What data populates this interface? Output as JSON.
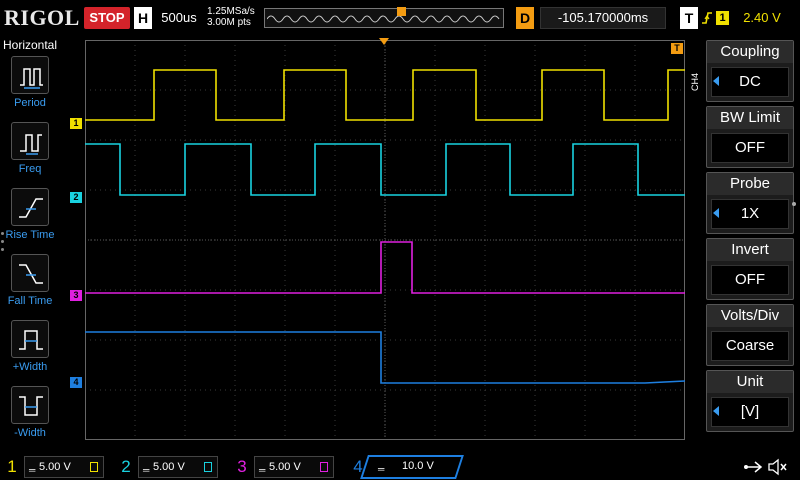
{
  "topbar": {
    "brand": "RIGOL",
    "run_status": "STOP",
    "horizontal_badge": "H",
    "timebase": "500us",
    "sample_rate": "1.25MSa/s",
    "memory_depth": "3.00M pts",
    "delay_badge": "D",
    "delay_value": "-105.170000ms",
    "trigger_badge": "T",
    "trigger_edge_icon": "rising-edge-icon",
    "trigger_source": "1",
    "trigger_level": "2.40 V"
  },
  "left_panel": {
    "title": "Horizontal",
    "items": [
      {
        "label": "Period",
        "icon": "period-icon"
      },
      {
        "label": "Freq",
        "icon": "freq-icon"
      },
      {
        "label": "Rise Time",
        "icon": "rise-time-icon"
      },
      {
        "label": "Fall Time",
        "icon": "fall-time-icon"
      },
      {
        "label": "+Width",
        "icon": "positive-width-icon"
      },
      {
        "label": "-Width",
        "icon": "negative-width-icon"
      }
    ]
  },
  "right_panel": {
    "channel_tab": "CH4",
    "items": [
      {
        "title": "Coupling",
        "value": "DC"
      },
      {
        "title": "BW Limit",
        "value": "OFF"
      },
      {
        "title": "Probe",
        "value": "1X"
      },
      {
        "title": "Invert",
        "value": "OFF"
      },
      {
        "title": "Volts/Div",
        "value": "Coarse"
      },
      {
        "title": "Unit",
        "value": "[V]"
      }
    ]
  },
  "channels": [
    {
      "num": "1",
      "scale": "5.00 V",
      "color": "#f0e000"
    },
    {
      "num": "2",
      "scale": "5.00 V",
      "color": "#19d2e0"
    },
    {
      "num": "3",
      "scale": "5.00 V",
      "color": "#e020e0"
    },
    {
      "num": "4",
      "scale": "10.0 V",
      "color": "#1e7fe0"
    }
  ],
  "colors": {
    "ch1": "#f0e000",
    "ch2": "#19d2e0",
    "ch3": "#e020e0",
    "ch4": "#1e7fe0",
    "stop": "#d4232a",
    "delay": "#f39c12",
    "accent": "#3a9cf0"
  }
}
